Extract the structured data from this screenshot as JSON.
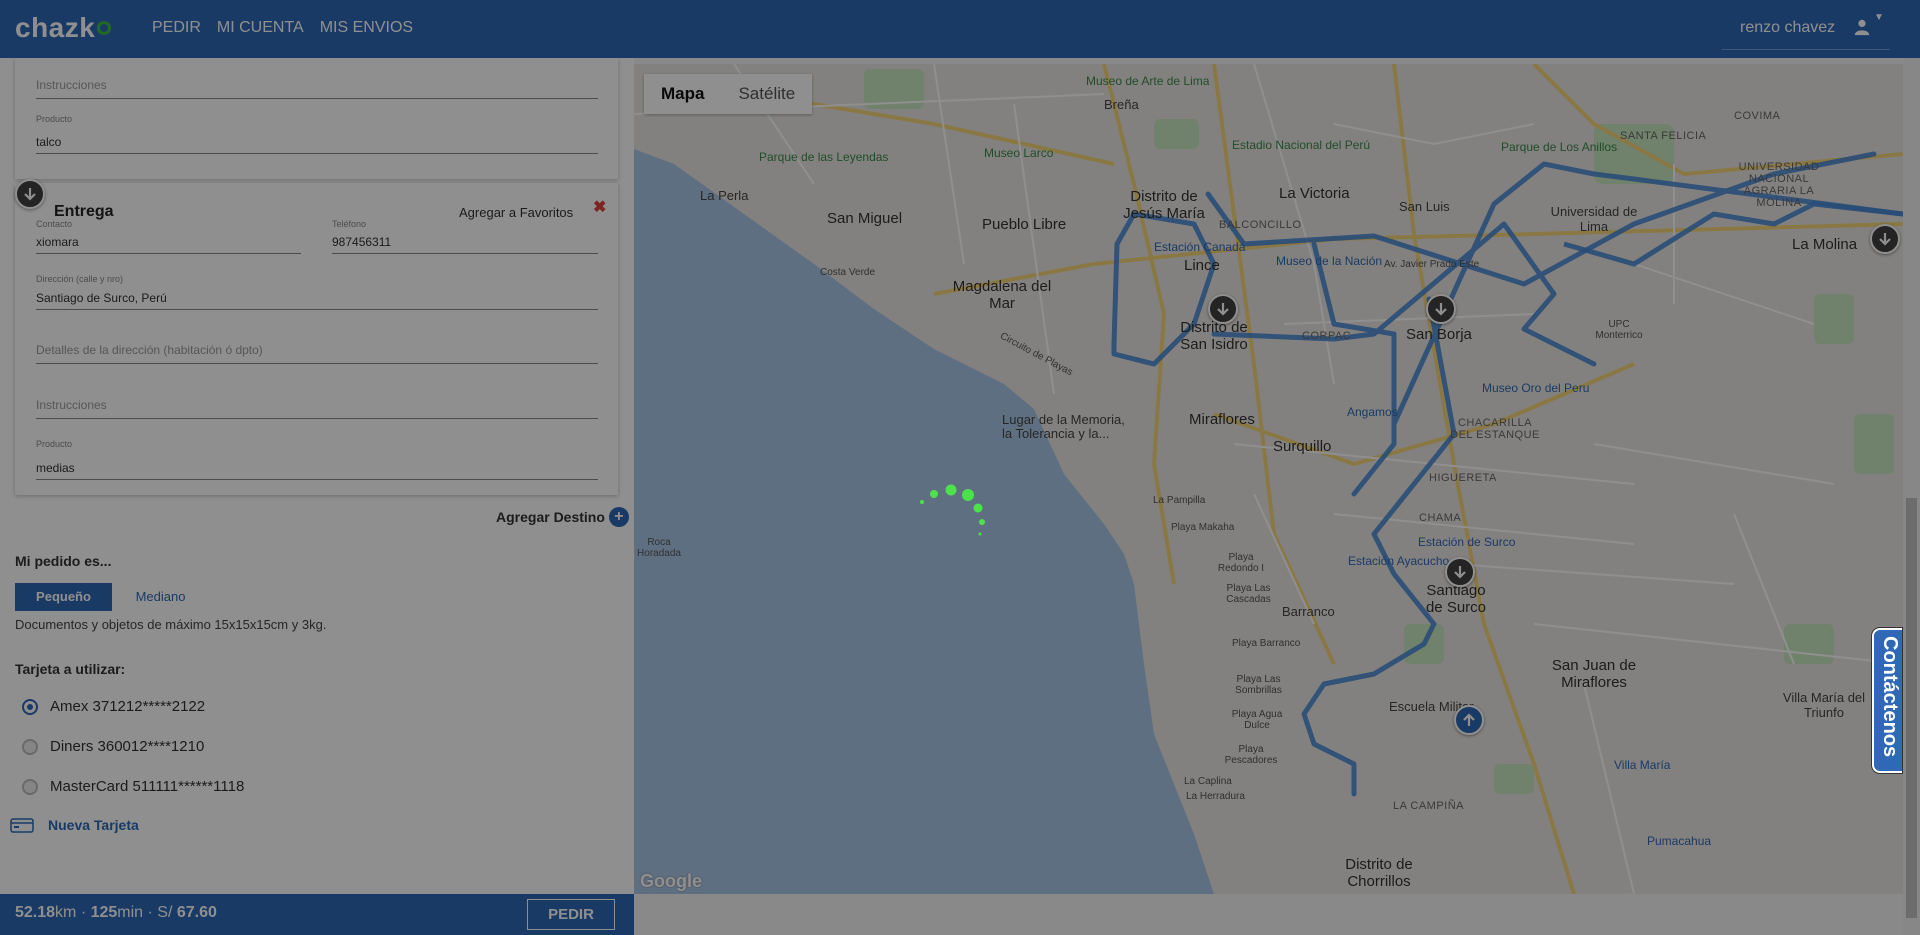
{
  "brand": {
    "name": "chazk",
    "accent": "#2f68b6",
    "logo_dot": "#3dbb3d"
  },
  "nav": {
    "items": [
      "PEDIR",
      "MI CUENTA",
      "MIS ENVIOS"
    ]
  },
  "user": {
    "name": "renzo chavez",
    "icon": "user-icon"
  },
  "pickup": {
    "instrucciones_placeholder": "Instrucciones",
    "producto_label": "Producto",
    "producto_value": "talco"
  },
  "delivery": {
    "title": "Entrega",
    "favorites_label": "Agregar a Favoritos",
    "close_icon": "close-icon",
    "contacto_label": "Contacto",
    "contacto_value": "xiomara",
    "telefono_label": "Teléfono",
    "telefono_value": "987456311",
    "direccion_label": "Dirección (calle y nro)",
    "direccion_value": "Santiago de Surco, Perú",
    "detalles_placeholder": "Detalles de la dirección (habitación ó dpto)",
    "instrucciones_placeholder": "Instrucciones",
    "producto_label": "Producto",
    "producto_value": "medias"
  },
  "add_destination": {
    "label": "Agregar Destino"
  },
  "order": {
    "title": "Mi pedido es...",
    "sizes": [
      "Pequeño",
      "Mediano"
    ],
    "selected_size": "Pequeño",
    "size_description": "Documentos y objetos de máximo 15x15x15cm y 3kg."
  },
  "cards": {
    "title": "Tarjeta a utilizar:",
    "options": [
      "Amex 371212*****2122",
      "Diners 360012****1210",
      "MasterCard 511111******1118"
    ],
    "selected": "Amex 371212*****2122",
    "new_card_label": "Nueva Tarjeta"
  },
  "summary": {
    "distance": "52.18",
    "distance_unit": "km · ",
    "time": "125",
    "time_unit": "min · S/ ",
    "price": "67.60",
    "button": "PEDIR"
  },
  "map": {
    "tabs": [
      "Mapa",
      "Satélite"
    ],
    "active_tab": "Mapa",
    "attribution": "Google",
    "labels": {
      "museo_arte": "Museo de Arte de Lima",
      "brena": "Breña",
      "parque_leyendas": "Parque de las Leyendas",
      "museo_larco": "Museo Larco",
      "estadio": "Estadio Nacional del Perú",
      "parque_anillos": "Parque de Los Anillos",
      "santa_felicia": "SANTA FELICIA",
      "covima": "COVIMA",
      "universidad_nacional": "UNIVERSIDAD NACIONAL AGRARIA LA MOLINA",
      "la_perla": "La Perla",
      "san_miguel": "San Miguel",
      "pueblo_libre": "Pueblo Libre",
      "jesus_maria": "Distrito de Jesús María",
      "la_victoria": "La Victoria",
      "balconcillo": "BALCONCILLO",
      "san_luis": "San Luis",
      "universidad_lima": "Universidad de Lima",
      "la_molina": "La Molina",
      "costa_verde": "Costa Verde",
      "estacion_canada": "Estación Canadá",
      "museo_nacion": "Museo de la Nación",
      "lince": "Lince",
      "javier_prado": "Av. Javier Prado Este",
      "magdalena": "Magdalena del Mar",
      "san_isidro": "Distrito de San Isidro",
      "corpac": "CORPAC",
      "san_borja": "San Borja",
      "upc": "UPC Monterrico",
      "circuito_playas": "Circuito de Playas",
      "museo_oro": "Museo Oro del Peru",
      "lugar_memoria": "Lugar de la Memoria, la Tolerancia y la...",
      "miraflores": "Miraflores",
      "angamos": "Angamos",
      "chacarilla": "CHACARILLA DEL ESTANQUE",
      "surquillo": "Surquillo",
      "higuereta": "HIGUERETA",
      "la_pampilla": "La Pampilla",
      "playa_makaha": "Playa Makaha",
      "chama": "CHAMA",
      "estacion_surco": "Estación de Surco",
      "estacion_ayacucho": "Estación Ayacucho",
      "roca_horadada": "Roca Horadada",
      "playa_redondo": "Playa Redondo I",
      "playa_cascadas": "Playa Las Cascadas",
      "barranco": "Barranco",
      "santiago_surco": "Santiago de Surco",
      "playa_barranco": "Playa Barranco",
      "san_juan": "San Juan de Miraflores",
      "villa_maria": "Villa María del Triunfo",
      "playa_sombrillas": "Playa Las Sombrillas",
      "playa_agua_dulce": "Playa Agua Dulce",
      "escuela_militar": "Escuela Militar",
      "playa_pescadores": "Playa Pescadores",
      "villa_maria_small": "Villa María",
      "la_caplina": "La Caplina",
      "la_herradura": "La Herradura",
      "la_campina": "LA CAMPIÑA",
      "pumacahua": "Pumacahua",
      "chorrillos": "Distrito de Chorrillos"
    }
  },
  "contact": {
    "label": "Contáctenos"
  }
}
